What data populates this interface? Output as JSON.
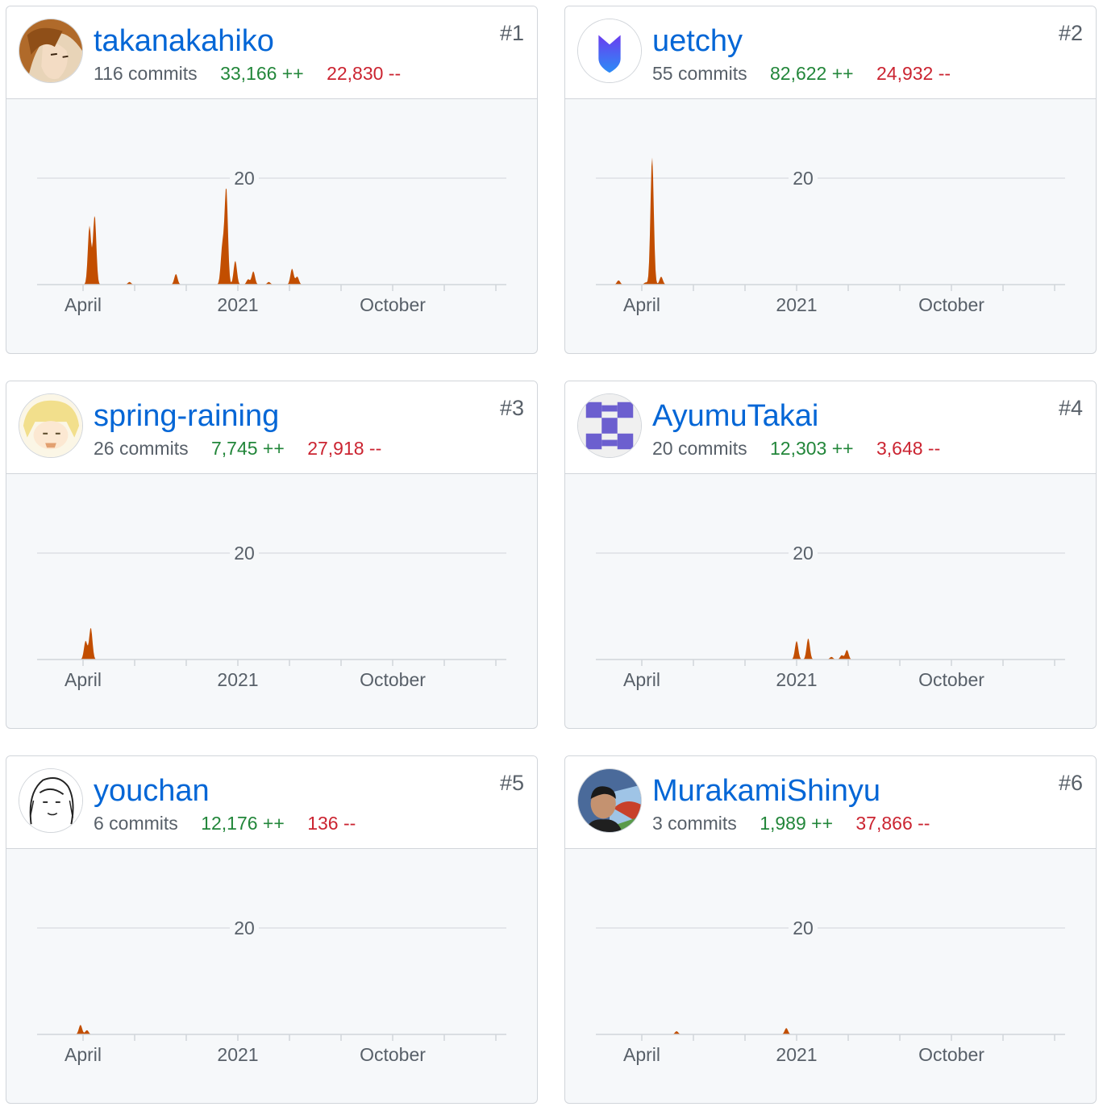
{
  "contributors": [
    {
      "rank": "#1",
      "username": "takanakahiko",
      "commits": "116 commits",
      "additions": "33,166 ++",
      "deletions": "22,830 --",
      "avatar_icon": "anime-girl-avatar-icon"
    },
    {
      "rank": "#2",
      "username": "uetchy",
      "commits": "55 commits",
      "additions": "82,622 ++",
      "deletions": "24,932 --",
      "avatar_icon": "shield-logo-avatar-icon"
    },
    {
      "rank": "#3",
      "username": "spring-raining",
      "commits": "26 commits",
      "additions": "7,745 ++",
      "deletions": "27,918 --",
      "avatar_icon": "blonde-character-avatar-icon"
    },
    {
      "rank": "#4",
      "username": "AyumuTakai",
      "commits": "20 commits",
      "additions": "12,303 ++",
      "deletions": "3,648 --",
      "avatar_icon": "identicon-avatar-icon"
    },
    {
      "rank": "#5",
      "username": "youchan",
      "commits": "6 commits",
      "additions": "12,176 ++",
      "deletions": "136 --",
      "avatar_icon": "sketch-portrait-avatar-icon"
    },
    {
      "rank": "#6",
      "username": "MurakamiShinyu",
      "commits": "3 commits",
      "additions": "1,989 ++",
      "deletions": "37,866 --",
      "avatar_icon": "photo-portrait-avatar-icon"
    }
  ],
  "colors": {
    "area": "#c24e00",
    "link": "#0366d6",
    "additions": "#22863a",
    "deletions": "#cb2431"
  },
  "chart_data": [
    {
      "type": "area",
      "contributor": "takanakahiko",
      "x_tick_labels": [
        "April",
        "2021",
        "October"
      ],
      "y_tick_labels": [
        "20"
      ],
      "ylim": [
        0,
        20
      ],
      "grid": true,
      "x_months": [
        1.0,
        2.0,
        3.0,
        4.0,
        5.0,
        6.0,
        7.0,
        8.0,
        9.0,
        10.0
      ],
      "peaks": [
        {
          "month": 0.25,
          "commits": 11
        },
        {
          "month": 0.45,
          "commits": 13
        },
        {
          "month": 1.8,
          "commits": 0.5
        },
        {
          "month": 3.6,
          "commits": 2
        },
        {
          "month": 5.4,
          "commits": 7
        },
        {
          "month": 5.55,
          "commits": 18
        },
        {
          "month": 5.9,
          "commits": 4.5
        },
        {
          "month": 6.4,
          "commits": 1
        },
        {
          "month": 6.6,
          "commits": 2.5
        },
        {
          "month": 7.2,
          "commits": 0.5
        },
        {
          "month": 8.1,
          "commits": 3
        },
        {
          "month": 8.3,
          "commits": 1.5
        }
      ]
    },
    {
      "type": "area",
      "contributor": "uetchy",
      "x_tick_labels": [
        "April",
        "2021",
        "October"
      ],
      "y_tick_labels": [
        "20"
      ],
      "ylim": [
        0,
        20
      ],
      "grid": true,
      "peaks": [
        {
          "month": -0.9,
          "commits": 0.8
        },
        {
          "month": 0.15,
          "commits": 0.4
        },
        {
          "month": 0.4,
          "commits": 24
        },
        {
          "month": 0.75,
          "commits": 1.5
        }
      ]
    },
    {
      "type": "area",
      "contributor": "spring-raining",
      "x_tick_labels": [
        "April",
        "2021",
        "October"
      ],
      "y_tick_labels": [
        "20"
      ],
      "ylim": [
        0,
        20
      ],
      "grid": true,
      "peaks": [
        {
          "month": 0.1,
          "commits": 3.5
        },
        {
          "month": 0.3,
          "commits": 6
        }
      ]
    },
    {
      "type": "area",
      "contributor": "AyumuTakai",
      "x_tick_labels": [
        "April",
        "2021",
        "October"
      ],
      "y_tick_labels": [
        "20"
      ],
      "ylim": [
        0,
        20
      ],
      "grid": true,
      "peaks": [
        {
          "month": 6.0,
          "commits": 3.5
        },
        {
          "month": 6.45,
          "commits": 4
        },
        {
          "month": 7.35,
          "commits": 0.5
        },
        {
          "month": 7.75,
          "commits": 0.8
        },
        {
          "month": 7.95,
          "commits": 1.8
        }
      ]
    },
    {
      "type": "area",
      "contributor": "youchan",
      "x_tick_labels": [
        "April",
        "2021",
        "October"
      ],
      "y_tick_labels": [
        "20"
      ],
      "ylim": [
        0,
        20
      ],
      "grid": true,
      "peaks": [
        {
          "month": -0.1,
          "commits": 1.8
        },
        {
          "month": 0.15,
          "commits": 0.8
        }
      ]
    },
    {
      "type": "area",
      "contributor": "MurakamiShinyu",
      "x_tick_labels": [
        "April",
        "2021",
        "October"
      ],
      "y_tick_labels": [
        "20"
      ],
      "ylim": [
        0,
        20
      ],
      "grid": true,
      "peaks": [
        {
          "month": 1.35,
          "commits": 0.6
        },
        {
          "month": 5.6,
          "commits": 1.2
        }
      ]
    }
  ]
}
